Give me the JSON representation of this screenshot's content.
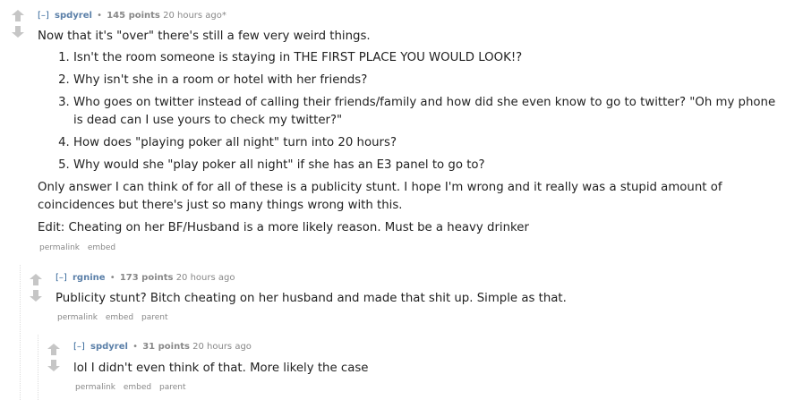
{
  "comments": [
    {
      "toggle": "[–]",
      "author": "spdyrel",
      "score": "145 points",
      "time": "20 hours ago*",
      "intro": "Now that it's \"over\" there's still a few very weird things.",
      "list": [
        "Isn't the room someone is staying in THE FIRST PLACE YOU WOULD LOOK!?",
        "Why isn't she in a room or hotel with her friends?",
        "Who goes on twitter instead of calling their friends/family and how did she even know to go to twitter? \"Oh my phone is dead can I use yours to check my twitter?\"",
        "How does \"playing poker all night\" turn into 20 hours?",
        "Why would she \"play poker all night\" if she has an E3 panel to go to?"
      ],
      "outro": "Only answer I can think of for all of these is a publicity stunt. I hope I'm wrong and it really was a stupid amount of coincidences but there's just so many things wrong with this.",
      "edit": "Edit: Cheating on her BF/Husband is a more likely reason. Must be a heavy drinker",
      "buttons": [
        "permalink",
        "embed"
      ]
    },
    {
      "toggle": "[–]",
      "author": "rgnine",
      "score": "173 points",
      "time": "20 hours ago",
      "text": "Publicity stunt? Bitch cheating on her husband and made that shit up. Simple as that.",
      "buttons": [
        "permalink",
        "embed",
        "parent"
      ]
    },
    {
      "toggle": "[–]",
      "author": "spdyrel",
      "score": "31 points",
      "time": "20 hours ago",
      "text": "lol I didn't even think of that. More likely the case",
      "buttons": [
        "permalink",
        "embed",
        "parent"
      ]
    }
  ],
  "icons": {
    "up": "upvote-arrow",
    "down": "downvote-arrow"
  },
  "colors": {
    "author": "#5a7fa8",
    "meta": "#888888",
    "arrow": "#c6c6c6"
  }
}
